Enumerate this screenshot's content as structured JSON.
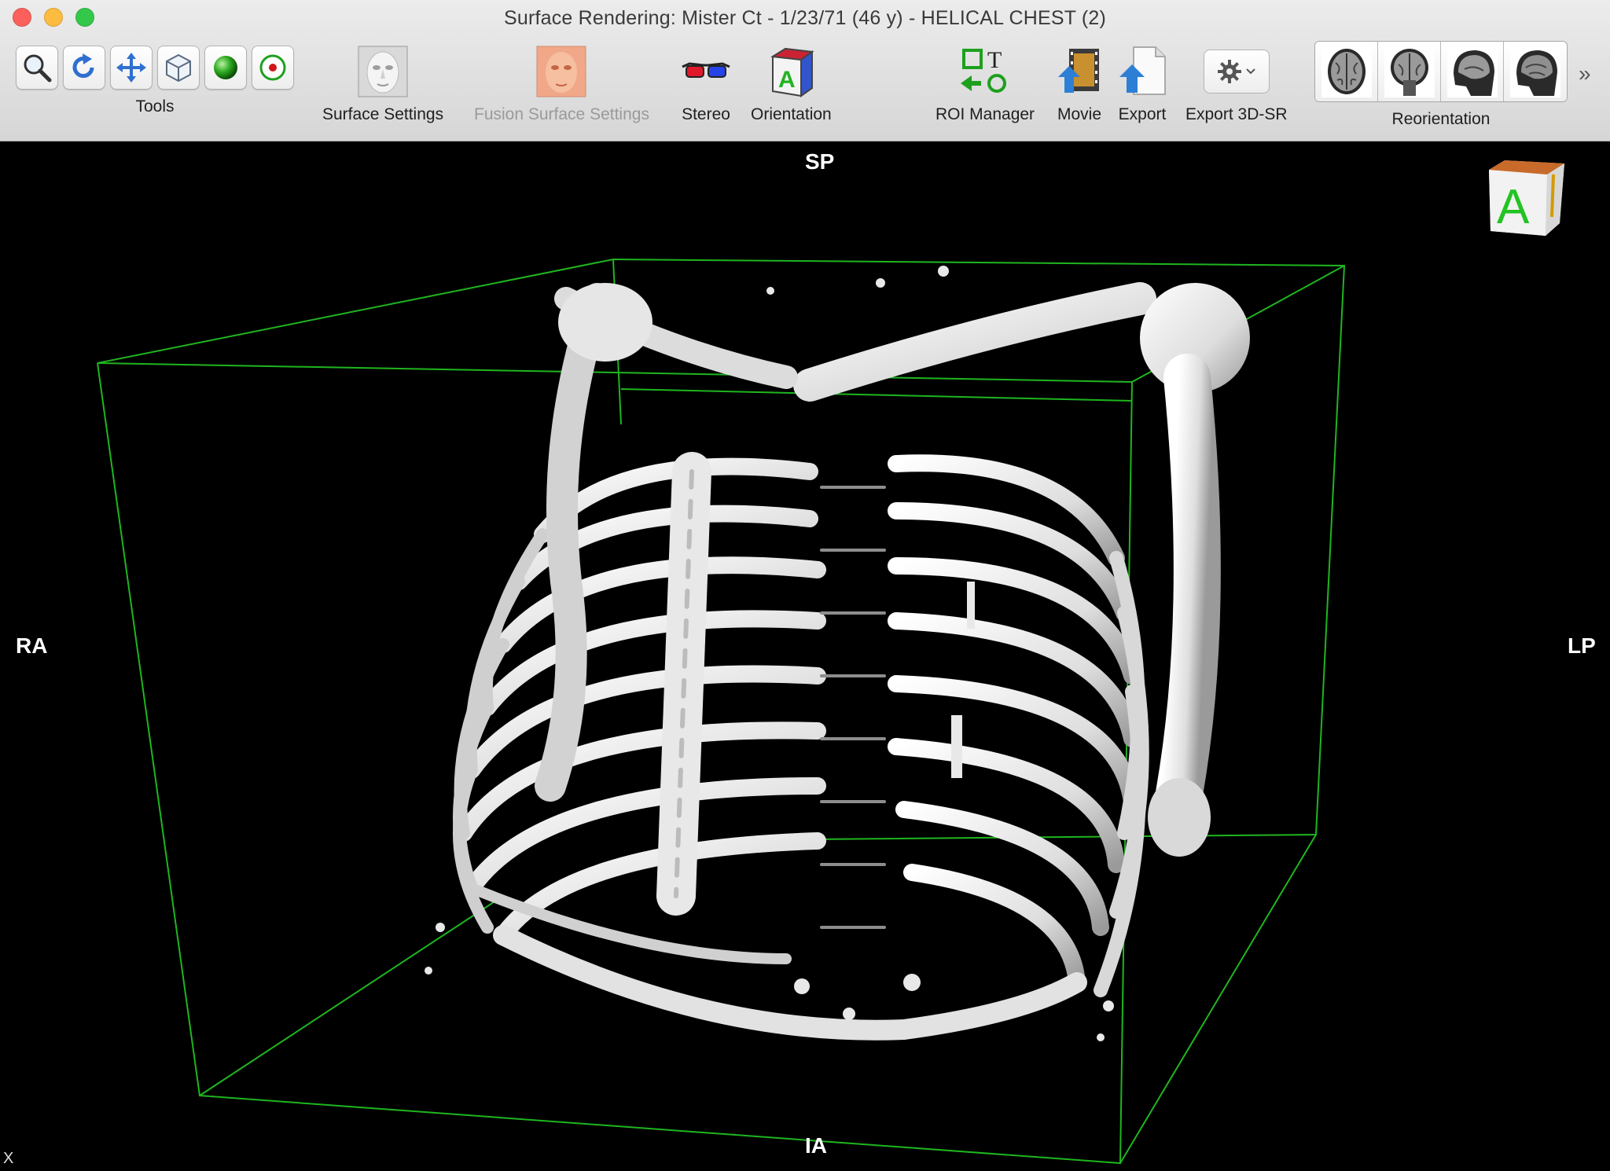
{
  "window": {
    "title": "Surface Rendering: Mister Ct - 1/23/71 (46 y) - HELICAL CHEST (2)"
  },
  "toolbar": {
    "tools_label": "Tools",
    "tools": [
      {
        "icon": "magnifier-icon"
      },
      {
        "icon": "rotate-icon"
      },
      {
        "icon": "move-icon"
      },
      {
        "icon": "cube-icon"
      },
      {
        "icon": "green-sphere-icon"
      },
      {
        "icon": "target-point-icon"
      }
    ],
    "surface_settings_label": "Surface Settings",
    "fusion_surface_settings_label": "Fusion Surface Settings",
    "stereo_label": "Stereo",
    "orientation_label": "Orientation",
    "roi_manager_label": "ROI Manager",
    "movie_label": "Movie",
    "export_label": "Export",
    "export_3dsr_label": "Export 3D-SR",
    "reorientation_label": "Reorientation",
    "overflow": "»"
  },
  "viewport": {
    "label_top": "SP",
    "label_bottom": "IA",
    "label_left": "RA",
    "label_right": "LP",
    "corner_label": "X",
    "orientation_cube_letter": "A",
    "bbox_color": "#1fb51f",
    "bone_color": "#e6e6e6"
  }
}
